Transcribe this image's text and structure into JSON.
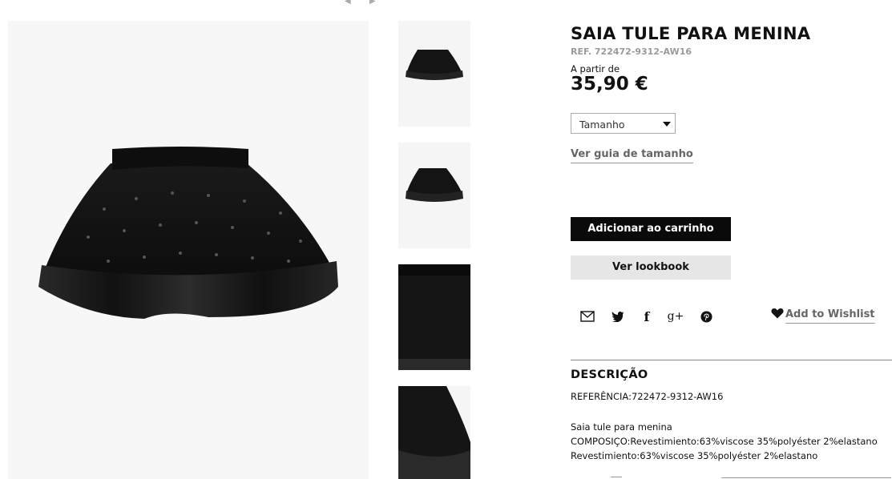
{
  "product": {
    "title": "SAIA TULE PARA MENINA",
    "ref": "REF. 722472-9312-AW16",
    "price_from": "A partir de",
    "price": "35,90 €"
  },
  "size_select": {
    "selected": "Tamanho"
  },
  "size_guide_label": "Ver guia de tamanho",
  "buttons": {
    "add_to_cart": "Adicionar ao carrinho",
    "lookbook": "Ver lookbook"
  },
  "social_icons": [
    "email-icon",
    "twitter-icon",
    "facebook-icon",
    "google-plus-icon",
    "pinterest-icon"
  ],
  "social_glyphs": {
    "facebook": "f",
    "google_plus": "g+"
  },
  "wishlist": {
    "label": "Add to Wishlist"
  },
  "description": {
    "title": "DESCRIÇÃO",
    "referencia": "REFERÊNCIA:722472-9312-AW16",
    "lines": [
      "Saia tule para menina",
      "COMPOSIÇO:Revestimiento:63%viscose 35%polyéster 2%elastano",
      "Revestimiento:63%viscose 35%polyéster 2%elastano"
    ]
  },
  "colors": {
    "cart_button_bg": "#0a0a0a",
    "lookbook_button_bg": "#e6e6e6",
    "ref_grey": "#9a9a9a",
    "link_grey": "#666666"
  }
}
